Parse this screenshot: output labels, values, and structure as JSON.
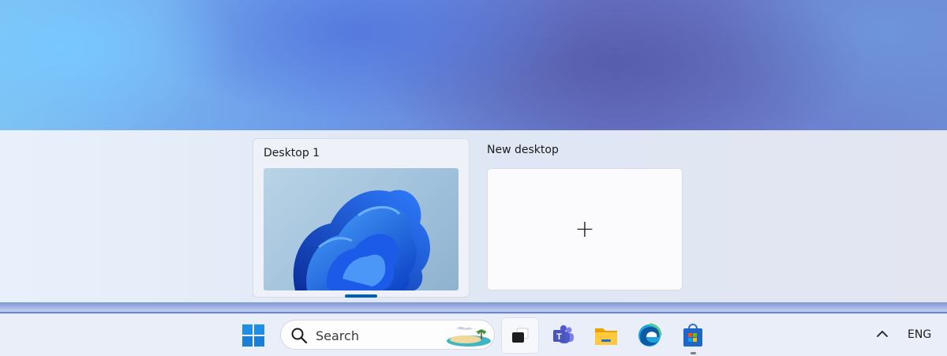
{
  "virtual_desktops": {
    "desktops": [
      {
        "label": "Desktop 1",
        "active": true
      }
    ],
    "new_desktop_label": "New desktop",
    "new_desktop_symbol": "+"
  },
  "taskbar": {
    "search": {
      "label": "Search",
      "icon": "search-icon"
    },
    "apps": [
      {
        "name": "Start",
        "icon": "windows-logo-icon"
      },
      {
        "name": "Task View",
        "icon": "task-view-icon",
        "active": true
      },
      {
        "name": "Microsoft Teams",
        "icon": "teams-icon"
      },
      {
        "name": "File Explorer",
        "icon": "folder-icon"
      },
      {
        "name": "Microsoft Edge",
        "icon": "edge-icon"
      },
      {
        "name": "Microsoft Store",
        "icon": "store-icon",
        "running": true
      }
    ],
    "tray": {
      "overflow_icon": "chevron-up-icon",
      "language": "ENG"
    }
  },
  "colors": {
    "accent": "#005fb8",
    "windows_blue": "#1f8fe6"
  }
}
